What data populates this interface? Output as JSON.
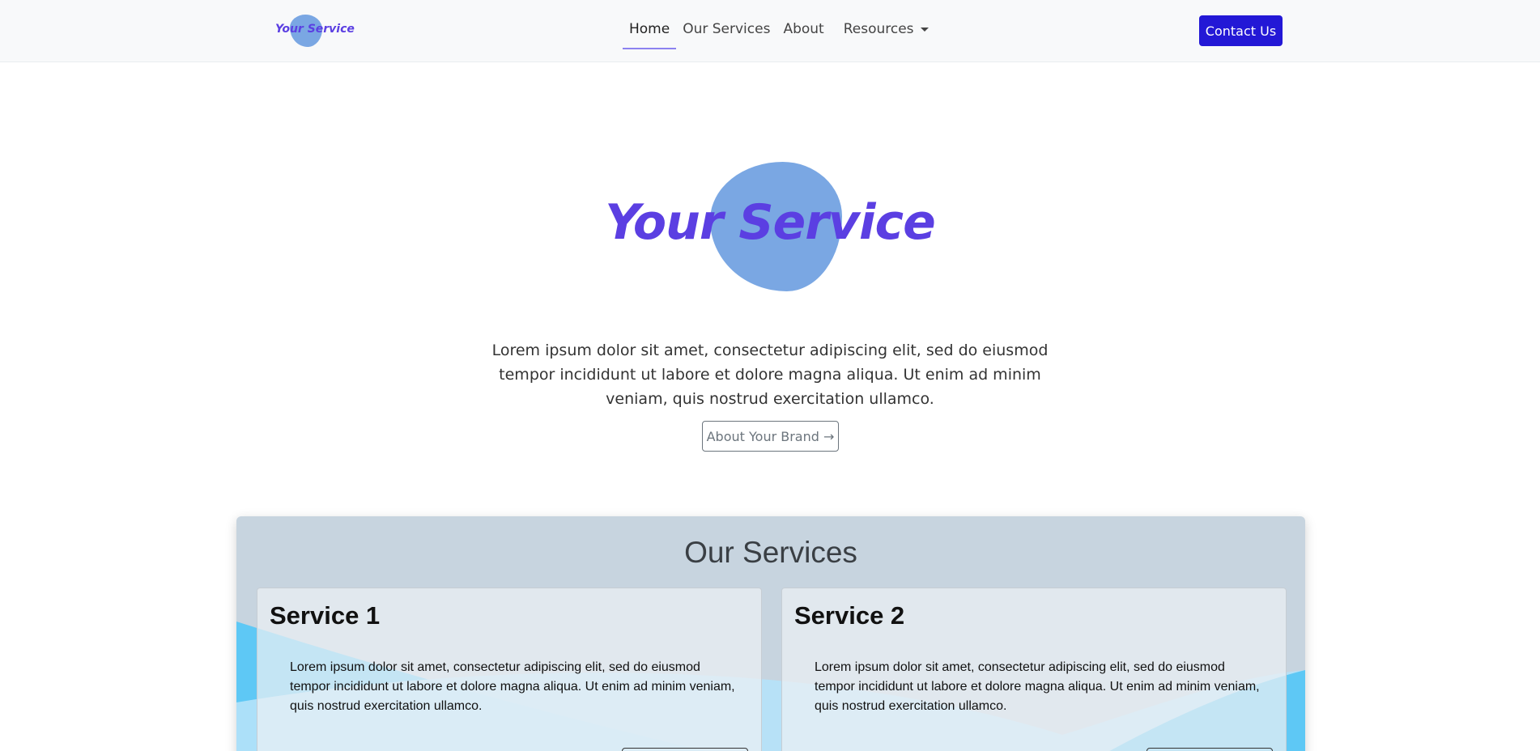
{
  "navbar": {
    "brand": "Your Service",
    "items": [
      {
        "label": "Home"
      },
      {
        "label": "Our Services"
      },
      {
        "label": "About"
      },
      {
        "label": "Resources"
      }
    ],
    "contact_label": "Contact Us"
  },
  "hero": {
    "title": "Your Service",
    "text": "Lorem ipsum dolor sit amet, consectetur adipiscing elit, sed do eiusmod tempor incididunt ut labore et dolore magna aliqua. Ut enim ad minim veniam, quis nostrud exercitation ullamco.",
    "button_label": "About Your Brand →"
  },
  "services": {
    "title": "Our Services",
    "cards": [
      {
        "title": "Service 1",
        "text": "Lorem ipsum dolor sit amet, consectetur adipiscing elit, sed do eiusmod tempor incididunt ut labore et dolore magna aliqua. Ut enim ad minim veniam, quis nostrud exercitation ullamco."
      },
      {
        "title": "Service 2",
        "text": "Lorem ipsum dolor sit amet, consectetur adipiscing elit, sed do eiusmod tempor incididunt ut labore et dolore magna aliqua. Ut enim ad minim veniam, quis nostrud exercitation ullamco."
      }
    ]
  },
  "colors": {
    "brand": "#5b3fe2",
    "blob": "#7aa7e3",
    "primary_button": "#2318d6",
    "services_bg": "#c7d4df"
  }
}
